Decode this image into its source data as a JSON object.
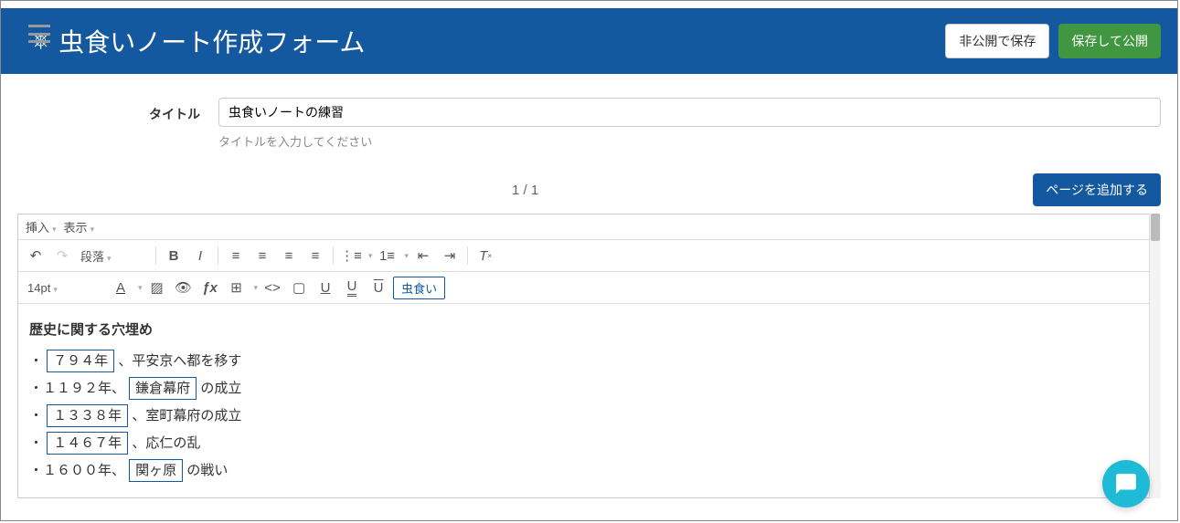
{
  "header": {
    "icon_glyph": "⎈",
    "title": "虫食いノート作成フォーム",
    "save_private_label": "非公開で保存",
    "save_publish_label": "保存して公開"
  },
  "title_field": {
    "label": "タイトル",
    "value": "虫食いノートの練習",
    "help": "タイトルを入力してください"
  },
  "pages": {
    "indicator": "1 / 1",
    "add_page_label": "ページを追加する"
  },
  "editor": {
    "menubar": {
      "insert": "挿入",
      "view": "表示"
    },
    "format_select": "段落",
    "font_size": "14pt",
    "mushikui_label": "虫食い"
  },
  "content": {
    "heading": "歴史に関する穴埋め",
    "lines": [
      {
        "prefix": "・ ",
        "blank": "７９４年",
        "suffix": " 、平安京へ都を移す"
      },
      {
        "prefix": "・１１９２年、 ",
        "blank": "鎌倉幕府",
        "suffix": " の成立"
      },
      {
        "prefix": "・ ",
        "blank": "１３３８年",
        "suffix": " 、室町幕府の成立"
      },
      {
        "prefix": "・ ",
        "blank": "１４６７年",
        "suffix": " 、応仁の乱"
      },
      {
        "prefix": "・１６００年、 ",
        "blank": "関ヶ原",
        "suffix": " の戦い"
      }
    ]
  }
}
